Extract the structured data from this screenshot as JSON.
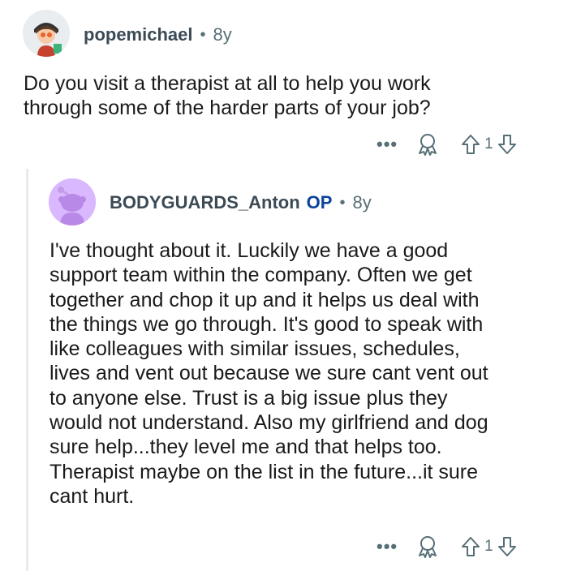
{
  "parent_comment": {
    "username": "popemichael",
    "separator": "•",
    "age": "8y",
    "text": "Do you visit a therapist at all to help you work\nthrough some of the harder parts of your job?",
    "more_label": "•••",
    "vote_count": "1"
  },
  "reply_comment": {
    "username": "BODYGUARDS_Anton",
    "op_badge": "OP",
    "separator": "•",
    "age": "8y",
    "text": "I've thought about it.  Luckily we have a good\nsupport team within the company.  Often we get\ntogether and chop it up and it helps us deal with\nthe things we go through.  It's good to speak with\nlike colleagues with similar issues, schedules,\nlives and vent out because we sure cant vent out\nto anyone else.  Trust is a big issue plus they\nwould not understand.  Also my girlfriend and dog\nsure help...they level me and that helps too.\nTherapist maybe on the list in the future...it sure\ncant hurt.",
    "more_label": "•••",
    "vote_count": "1"
  },
  "colors": {
    "text": "#1a1a1b",
    "meta": "#576f76",
    "op": "#0a449b",
    "thread_line": "#e5ebee",
    "avatar2_bg": "#d9b8ff"
  },
  "icons": [
    "award-icon",
    "upvote-icon",
    "downvote-icon",
    "more-options-icon",
    "avatar-icon"
  ]
}
